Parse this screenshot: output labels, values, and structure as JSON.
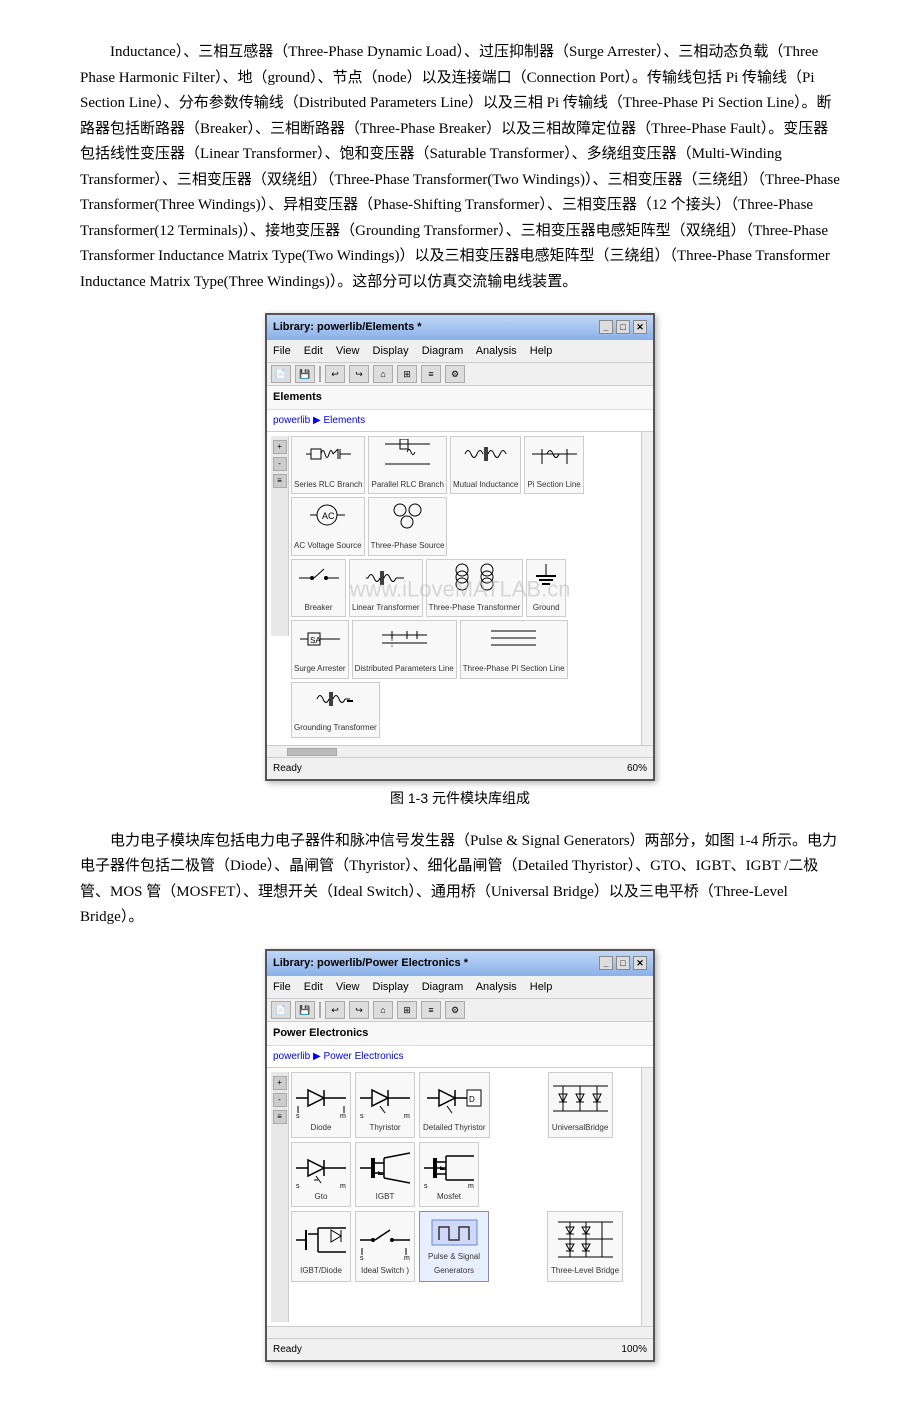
{
  "paragraphs": {
    "p1": "Inductance）、三相互感器（Three-Phase Dynamic Load）、过压抑制器（Surge Arrester）、三相动态负载（Three Phase Harmonic Filter）、地（ground）、节点（node）以及连接端口（Connection Port）。传输线包括 Pi 传输线（Pi Section Line）、分布参数传输线（Distributed Parameters Line）以及三相 Pi 传输线（Three-Phase Pi Section Line）。断路器包括断路器（Breaker）、三相断路器（Three-Phase Breaker）以及三相故障定位器（Three-Phase Fault）。变压器包括线性变压器（Linear Transformer）、饱和变压器（Saturable Transformer）、多绕组变压器（Multi-Winding Transformer）、三相变压器（双绕组）（Three-Phase Transformer(Two Windings)）、三相变压器（三绕组）（Three-Phase Transformer(Three Windings)）、异相变压器（Phase-Shifting Transformer）、三相变压器（12 个接头）（Three-Phase Transformer(12 Terminals)）、接地变压器（Grounding Transformer）、三相变压器电感矩阵型（双绕组）（Three-Phase Transformer Inductance Matrix Type(Two Windings)）以及三相变压器电感矩阵型（三绕组）（Three-Phase Transformer Inductance Matrix Type(Three Windings)）。这部分可以仿真交流输电线装置。",
    "fig1_caption": "图 1-3 元件模块库组成",
    "p2": "电力电子模块库包括电力电子器件和脉冲信号发生器（Pulse & Signal Generators）两部分，如图 1-4 所示。电力电子器件包括二极管（Diode）、晶闸管（Thyristor）、细化晶闸管（Detailed Thyristor）、GTO、IGBT、IGBT /二极管、MOS 管（MOSFET）、理想开关（Ideal Switch）、通用桥（Universal Bridge）以及三电平桥（Three-Level Bridge）。"
  },
  "window1": {
    "title": "Library: powerlib/Elements *",
    "menu": [
      "File",
      "Edit",
      "View",
      "Display",
      "Diagram",
      "Analysis",
      "Help"
    ],
    "section_label": "Elements",
    "breadcrumb": "powerlib ▶ Elements",
    "status_left": "Ready",
    "status_right": "60%",
    "watermark": "www.iLoveMATLAB.cn"
  },
  "window2": {
    "title": "Library: powerlib/Power Electronics *",
    "menu": [
      "File",
      "Edit",
      "View",
      "Display",
      "Diagram",
      "Analysis",
      "Help"
    ],
    "section_label": "Power Electronics",
    "breadcrumb": "powerlib ▶ Power Electronics",
    "status_left": "Ready",
    "status_right": "100%",
    "components": [
      {
        "label": "Diode",
        "symbol": "⊳|"
      },
      {
        "label": "Thyristor",
        "symbol": "⊳|"
      },
      {
        "label": "Detailed Thyristor",
        "symbol": "⊳|"
      },
      {
        "label": "",
        "symbol": ""
      },
      {
        "label": "UniversalBridge",
        "symbol": "▦"
      },
      {
        "label": "Gto",
        "symbol": "⊳|"
      },
      {
        "label": "IGBT",
        "symbol": "⊳|"
      },
      {
        "label": "Mosfet",
        "symbol": "⊳|"
      },
      {
        "label": "",
        "symbol": ""
      },
      {
        "label": "",
        "symbol": ""
      },
      {
        "label": "IGBT/Diode",
        "symbol": "⊳|"
      },
      {
        "label": "Ideal Switch",
        "symbol": "⊘"
      },
      {
        "label": "Pulse & Signal\nGenerators",
        "symbol": "⊞"
      },
      {
        "label": "",
        "symbol": ""
      },
      {
        "label": "Three-Level Bridge",
        "symbol": "▦"
      }
    ]
  },
  "ideal_switch_label": "Ideal Switch )"
}
